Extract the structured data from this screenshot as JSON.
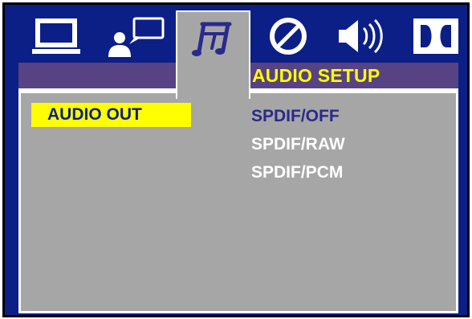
{
  "tabs": [
    {
      "id": "general",
      "icon": "monitor-icon"
    },
    {
      "id": "speech",
      "icon": "speech-person-icon"
    },
    {
      "id": "audio",
      "icon": "music-note-icon",
      "active": true
    },
    {
      "id": "video",
      "icon": "disc-icon"
    },
    {
      "id": "speaker",
      "icon": "speaker-icon"
    },
    {
      "id": "dolby",
      "icon": "dolby-icon"
    }
  ],
  "section_title": "AUDIO SETUP",
  "setting": {
    "label": "AUDIO OUT",
    "options": [
      "SPDIF/OFF",
      "SPDIF/RAW",
      "SPDIF/PCM"
    ],
    "selected": "SPDIF/OFF"
  },
  "colors": {
    "background": "#0c1f87",
    "panel": "#a6a6a6",
    "band": "#574284",
    "highlight": "#ffff00",
    "selected_text": "#2a2a8c",
    "text": "#ffffff"
  }
}
